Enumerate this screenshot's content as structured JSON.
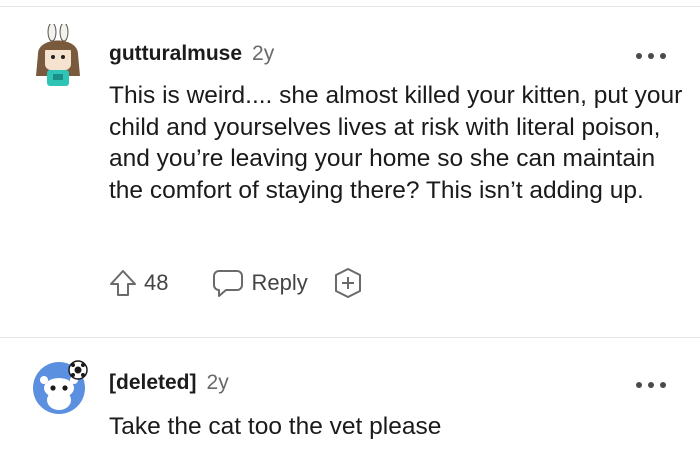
{
  "comments": [
    {
      "author": "gutturalmuse",
      "age": "2y",
      "text": "This is weird.... she almost killed your kitten, put your child and yourselves lives at risk with literal poison, and you’re leaving your home so she can maintain the comfort of staying there? This isn’t adding up.",
      "upvotes": "48",
      "reply_label": "Reply"
    },
    {
      "author": "[deleted]",
      "age": "2y",
      "text": "Take the cat too the vet please"
    }
  ],
  "colors": {
    "snoo_blue": "#5b8fe0",
    "avatar_teal": "#2ec4b6",
    "avatar_hair": "#7a5a3c",
    "icon_gray": "#6a6a6a"
  }
}
